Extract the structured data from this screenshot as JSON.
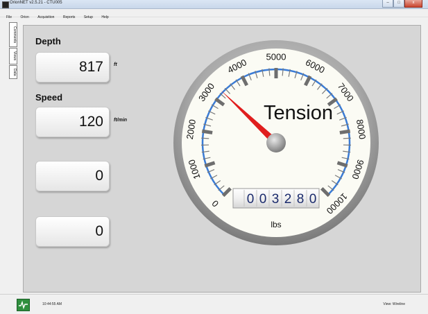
{
  "window": {
    "title": "OrionNET v2.5.21 - CTU005",
    "controls": {
      "minimize": "–",
      "maximize": "□",
      "close": "x"
    }
  },
  "menu": {
    "items": [
      "File",
      "Orion",
      "Acquisition",
      "Reports",
      "Setup",
      "Help"
    ]
  },
  "side_tabs": [
    "Comments",
    "Views",
    "Data"
  ],
  "readouts": {
    "depth_label": "Depth",
    "depth_value": "817",
    "depth_unit": "ft",
    "speed_label": "Speed",
    "speed_value": "120",
    "speed_unit": "ft/min",
    "box3_value": "0",
    "box4_value": "0"
  },
  "gauge": {
    "title": "Tension",
    "unit": "lbs",
    "min": 0,
    "max": 10000,
    "tick_labels": [
      "0",
      "1000",
      "2000",
      "3000",
      "4000",
      "5000",
      "6000",
      "7000",
      "8000",
      "9000",
      "10000"
    ],
    "value": 3280,
    "odometer_digits": [
      "0",
      "0",
      "3",
      "2",
      "8",
      "0"
    ],
    "colors": {
      "needle": "#e01e1e",
      "scale_arc": "#3a7bd5",
      "dial": "#fbfbf4"
    }
  },
  "status": {
    "icon": "chart-activity-icon",
    "time": "10:44:55 AM",
    "view": "View: Wireline"
  }
}
